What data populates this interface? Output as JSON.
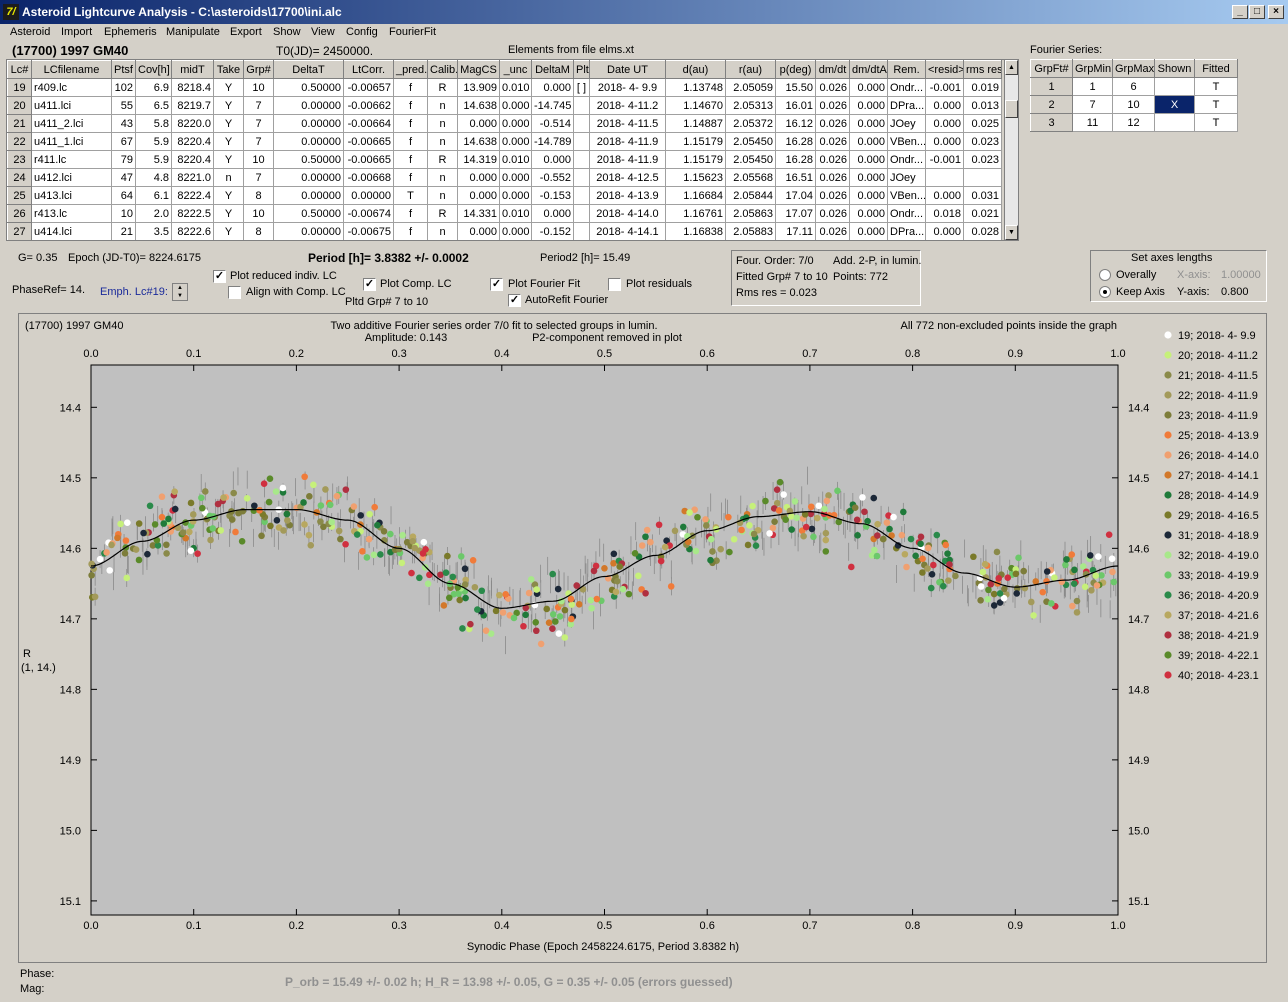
{
  "window": {
    "title": "Asteroid Lightcurve Analysis - C:\\asteroids\\17700\\ini.alc",
    "icon_glyph": "7/"
  },
  "menu": [
    "Asteroid",
    "Import",
    "Ephemeris",
    "Manipulate",
    "Export",
    "Show",
    "View",
    "Config",
    "FourierFit"
  ],
  "header": {
    "object": "(17700) 1997 GM40",
    "t0": "T0(JD)= 2450000.",
    "elements": "Elements from file elms.xt",
    "fourier_series_label": "Fourier Series:"
  },
  "grid": {
    "columns": [
      "Lc#",
      "LCfilename",
      "Ptsf",
      "Cov[h]",
      "midT",
      "Take",
      "Grp#",
      "DeltaT",
      "LtCorr.",
      "_pred.",
      "Calib.",
      "MagCS",
      "_unc",
      "DeltaM",
      "Plt",
      "Date UT",
      "d(au)",
      "r(au)",
      "p(deg)",
      "dm/dt",
      "dm/dtA",
      "Rem.",
      "<resid>",
      "rms res"
    ],
    "rows": [
      [
        "19",
        "r409.lc",
        "102",
        "6.9",
        "8218.4",
        "Y",
        "10",
        "0.50000",
        "-0.00657",
        "f",
        "R",
        "13.909",
        "0.010",
        "0.000",
        "[ ]",
        "2018- 4- 9.9",
        "1.13748",
        "2.05059",
        "15.50",
        "0.026",
        "0.000",
        "Ondr...",
        "-0.001",
        "0.019"
      ],
      [
        "20",
        "u411.lci",
        "55",
        "6.5",
        "8219.7",
        "Y",
        "7",
        "0.00000",
        "-0.00662",
        "f",
        "n",
        "14.638",
        "0.000",
        "-14.745",
        "",
        "2018- 4-11.2",
        "1.14670",
        "2.05313",
        "16.01",
        "0.026",
        "0.000",
        "DPra...",
        "0.000",
        "0.013"
      ],
      [
        "21",
        "u411_2.lci",
        "43",
        "5.8",
        "8220.0",
        "Y",
        "7",
        "0.00000",
        "-0.00664",
        "f",
        "n",
        "0.000",
        "0.000",
        "-0.514",
        "",
        "2018- 4-11.5",
        "1.14887",
        "2.05372",
        "16.12",
        "0.026",
        "0.000",
        "JOey",
        "0.000",
        "0.025"
      ],
      [
        "22",
        "u411_1.lci",
        "67",
        "5.9",
        "8220.4",
        "Y",
        "7",
        "0.00000",
        "-0.00665",
        "f",
        "n",
        "14.638",
        "0.000",
        "-14.789",
        "",
        "2018- 4-11.9",
        "1.15179",
        "2.05450",
        "16.28",
        "0.026",
        "0.000",
        "VBen...",
        "0.000",
        "0.023"
      ],
      [
        "23",
        "r411.lc",
        "79",
        "5.9",
        "8220.4",
        "Y",
        "10",
        "0.50000",
        "-0.00665",
        "f",
        "R",
        "14.319",
        "0.010",
        "0.000",
        "",
        "2018- 4-11.9",
        "1.15179",
        "2.05450",
        "16.28",
        "0.026",
        "0.000",
        "Ondr...",
        "-0.001",
        "0.023"
      ],
      [
        "24",
        "u412.lci",
        "47",
        "4.8",
        "8221.0",
        "n",
        "7",
        "0.00000",
        "-0.00668",
        "f",
        "n",
        "0.000",
        "0.000",
        "-0.552",
        "",
        "2018- 4-12.5",
        "1.15623",
        "2.05568",
        "16.51",
        "0.026",
        "0.000",
        "JOey",
        "",
        ""
      ],
      [
        "25",
        "u413.lci",
        "64",
        "6.1",
        "8222.4",
        "Y",
        "8",
        "0.00000",
        "0.00000",
        "T",
        "n",
        "0.000",
        "0.000",
        "-0.153",
        "",
        "2018- 4-13.9",
        "1.16684",
        "2.05844",
        "17.04",
        "0.026",
        "0.000",
        "VBen...",
        "0.000",
        "0.031"
      ],
      [
        "26",
        "r413.lc",
        "10",
        "2.0",
        "8222.5",
        "Y",
        "10",
        "0.50000",
        "-0.00674",
        "f",
        "R",
        "14.331",
        "0.010",
        "0.000",
        "",
        "2018- 4-14.0",
        "1.16761",
        "2.05863",
        "17.07",
        "0.026",
        "0.000",
        "Ondr...",
        "0.018",
        "0.021"
      ],
      [
        "27",
        "u414.lci",
        "21",
        "3.5",
        "8222.6",
        "Y",
        "8",
        "0.00000",
        "-0.00675",
        "f",
        "n",
        "0.000",
        "0.000",
        "-0.152",
        "",
        "2018- 4-14.1",
        "1.16838",
        "2.05883",
        "17.11",
        "0.026",
        "0.000",
        "DPra...",
        "0.000",
        "0.028"
      ]
    ]
  },
  "fourier_table": {
    "columns": [
      "GrpFt#",
      "GrpMin",
      "GrpMax",
      "Shown",
      "Fitted"
    ],
    "rows": [
      [
        "1",
        "1",
        "6",
        "",
        "T"
      ],
      [
        "2",
        "7",
        "10",
        "X",
        "T"
      ],
      [
        "3",
        "11",
        "12",
        "",
        "T"
      ]
    ]
  },
  "controls": {
    "g": "G= 0.35",
    "epoch": "Epoch (JD-T0)= 8224.6175",
    "period_label": "Period [h]=",
    "period_value": "3.8382 +/- 0.0002",
    "period2": "Period2 [h]= 15.49",
    "phaseref": "PhaseRef= 14.",
    "emph": "Emph. Lc#19:",
    "plot_reduced": "Plot reduced indiv. LC",
    "align_comp": "Align with Comp. LC",
    "plot_comp": "Plot Comp. LC",
    "pltd_grp": "Pltd Grp#  7  to   10",
    "plot_fourier": "Plot Fourier Fit",
    "autorefit": "AutoRefit Fourier",
    "plot_residuals": "Plot residuals",
    "info1": "Four. Order:  7/0",
    "info2": "Add. 2-P, in lumin.",
    "info3": "Fitted Grp# 7 to 10",
    "info4": "Points: 772",
    "info5": "Rms res       = 0.023",
    "axes_title": "Set axes lengths",
    "overally": "Overally",
    "keep_axis": "Keep Axis",
    "xaxis_label": "X-axis:",
    "xaxis_value": "1.00000",
    "yaxis_label": "Y-axis:",
    "yaxis_value": "0.800"
  },
  "plot": {
    "name": "(17700) 1997 GM40",
    "title_line1": "Two additive Fourier series order 7/0 fit to selected groups in lumin.",
    "title_line2": "Amplitude: 0.143",
    "title_line3": "P2-component removed in plot",
    "right_note": "All 772 non-excluded points inside the graph",
    "ylabel_line1": "R",
    "ylabel_line2": "(1, 14.)",
    "xlabel": "Synodic Phase (Epoch 2458224.6175, Period 3.8382 h)",
    "bg_color": "#c0c0c0",
    "legend": [
      {
        "label": "19; 2018- 4- 9.9",
        "color": "#ffffff"
      },
      {
        "label": "20; 2018- 4-11.2",
        "color": "#c6f07a"
      },
      {
        "label": "21; 2018- 4-11.5",
        "color": "#8a8a4a"
      },
      {
        "label": "22; 2018- 4-11.9",
        "color": "#a39a5a"
      },
      {
        "label": "23; 2018- 4-11.9",
        "color": "#7d7d3a"
      },
      {
        "label": "25; 2018- 4-13.9",
        "color": "#f07b3a"
      },
      {
        "label": "26; 2018- 4-14.0",
        "color": "#f0a070"
      },
      {
        "label": "27; 2018- 4-14.1",
        "color": "#d2782a"
      },
      {
        "label": "28; 2018- 4-14.9",
        "color": "#1f7a3a"
      },
      {
        "label": "29; 2018- 4-16.5",
        "color": "#7a7a2a"
      },
      {
        "label": "31; 2018- 4-18.9",
        "color": "#1c2838"
      },
      {
        "label": "32; 2018- 4-19.0",
        "color": "#a8e88a"
      },
      {
        "label": "33; 2018- 4-19.9",
        "color": "#6cc86a"
      },
      {
        "label": "36; 2018- 4-20.9",
        "color": "#2a8a4a"
      },
      {
        "label": "37; 2018- 4-21.6",
        "color": "#b8a860"
      },
      {
        "label": "38; 2018- 4-21.9",
        "color": "#b03040"
      },
      {
        "label": "39; 2018- 4-22.1",
        "color": "#5a8a2a"
      },
      {
        "label": "40; 2018- 4-23.1",
        "color": "#d03040"
      }
    ]
  },
  "chart_data": {
    "type": "scatter",
    "x_ticks": [
      "0.0",
      "0.1",
      "0.2",
      "0.3",
      "0.4",
      "0.5",
      "0.6",
      "0.7",
      "0.8",
      "0.9",
      "1.0"
    ],
    "y_ticks": [
      "14.4",
      "14.5",
      "14.6",
      "14.7",
      "14.8",
      "14.9",
      "15.0",
      "15.1"
    ],
    "xlim": [
      0,
      1
    ],
    "ylim": [
      14.34,
      15.12
    ],
    "y_inverted": true,
    "fourier_fit_curve": {
      "x": [
        0,
        0.05,
        0.1,
        0.15,
        0.2,
        0.25,
        0.3,
        0.35,
        0.4,
        0.45,
        0.5,
        0.55,
        0.6,
        0.65,
        0.7,
        0.75,
        0.8,
        0.85,
        0.9,
        0.95,
        1.0
      ],
      "y": [
        14.625,
        14.59,
        14.56,
        14.545,
        14.545,
        14.56,
        14.6,
        14.65,
        14.685,
        14.675,
        14.64,
        14.61,
        14.575,
        14.555,
        14.548,
        14.565,
        14.6,
        14.635,
        14.655,
        14.645,
        14.625
      ]
    }
  },
  "footer": {
    "phase_label": "Phase:",
    "mag_label": "Mag:",
    "summary": "P_orb = 15.49 +/- 0.02 h; H_R = 13.98 +/- 0.05, G = 0.35 +/- 0.05 (errors guessed)"
  }
}
